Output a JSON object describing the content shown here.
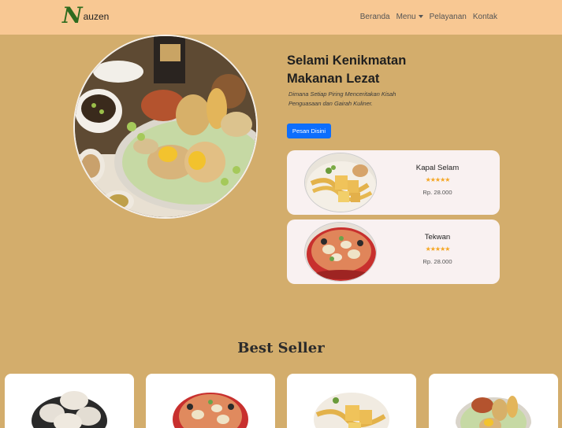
{
  "brand": {
    "initial": "N",
    "rest": "auzen"
  },
  "nav": {
    "items": [
      {
        "label": "Beranda"
      },
      {
        "label": "Menu"
      },
      {
        "label": "Pelayanan"
      },
      {
        "label": "Kontak"
      }
    ]
  },
  "hero": {
    "title_line1": "Selami Kenikmatan",
    "title_line2": "Makanan Lezat",
    "subtitle_line1": "Dimana Setiap Piring Menceritakan Kisah",
    "subtitle_line2": "Penguasaan dan Gairah Kuliner.",
    "cta_label": "Pesan Disini"
  },
  "menu_cards": [
    {
      "name": "Kapal Selam",
      "stars": "★★★★★",
      "rating": 5,
      "price": "Rp. 28.000"
    },
    {
      "name": "Tekwan",
      "stars": "★★★★★",
      "rating": 5,
      "price": "Rp. 28.000"
    }
  ],
  "best_seller": {
    "title": "Best Seller",
    "card_count_visible": 4
  },
  "colors": {
    "page_bg": "#d3ad6c",
    "navbar_bg": "#f8c893",
    "brand_green": "#2e6b1e",
    "cta_blue": "#0d6efd",
    "card_bg": "#f9f1f1",
    "star": "#f5a623"
  }
}
